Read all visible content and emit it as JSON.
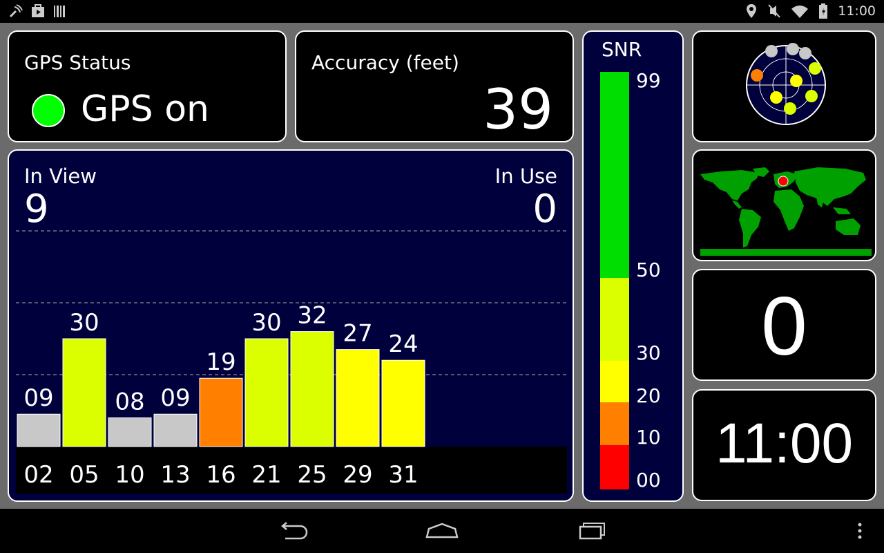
{
  "status_bar": {
    "time": "11:00",
    "left_icons": [
      "sync-icon",
      "play-store-icon",
      "barcode-icon"
    ],
    "right_icons": [
      "location-icon",
      "mute-icon",
      "wifi-icon",
      "battery-icon"
    ]
  },
  "gps_status": {
    "label": "GPS Status",
    "value": "GPS on",
    "indicator_color": "#00ff00"
  },
  "accuracy": {
    "label": "Accuracy (feet)",
    "value": "39"
  },
  "satellites": {
    "in_view_label": "In View",
    "in_view_value": "9",
    "in_use_label": "In Use",
    "in_use_value": "0"
  },
  "chart_data": {
    "type": "bar",
    "categories": [
      "02",
      "05",
      "10",
      "13",
      "16",
      "21",
      "25",
      "29",
      "31"
    ],
    "values": [
      9,
      30,
      8,
      9,
      19,
      30,
      32,
      27,
      24
    ],
    "value_labels": [
      "09",
      "30",
      "08",
      "09",
      "19",
      "30",
      "32",
      "27",
      "24"
    ],
    "colors": [
      "#c8c8c8",
      "#dcff00",
      "#c8c8c8",
      "#c8c8c8",
      "#ff8000",
      "#dcff00",
      "#dcff00",
      "#ffff00",
      "#ffff00"
    ],
    "ylim": [
      0,
      60
    ],
    "gridlines": [
      20,
      40,
      60
    ]
  },
  "snr_scale": {
    "title": "SNR",
    "tick_labels": [
      "99",
      "50",
      "30",
      "20",
      "10",
      "00"
    ],
    "bands": [
      {
        "from": 0,
        "to": 10,
        "color": "#ff0000"
      },
      {
        "from": 10,
        "to": 20,
        "color": "#ff8000"
      },
      {
        "from": 20,
        "to": 30,
        "color": "#ffff00"
      },
      {
        "from": 30,
        "to": 50,
        "color": "#dcff00"
      },
      {
        "from": 50,
        "to": 99,
        "color": "#00dd00"
      }
    ]
  },
  "sky_view": {
    "satellites": [
      {
        "color": "#c8c8c8"
      },
      {
        "color": "#c8c8c8"
      },
      {
        "color": "#c8c8c8"
      },
      {
        "color": "#ff8000"
      },
      {
        "color": "#dcff00"
      },
      {
        "color": "#ffff00"
      },
      {
        "color": "#dcff00"
      },
      {
        "color": "#ffff00"
      },
      {
        "color": "#dcff00"
      }
    ]
  },
  "world_map": {
    "land_color": "#00a000",
    "marker_color": "#ff0000"
  },
  "count_widget": {
    "value": "0"
  },
  "clock_widget": {
    "value": "11:00"
  },
  "nav_bar": {
    "buttons": [
      "back-button",
      "home-button",
      "recent-apps-button"
    ]
  }
}
